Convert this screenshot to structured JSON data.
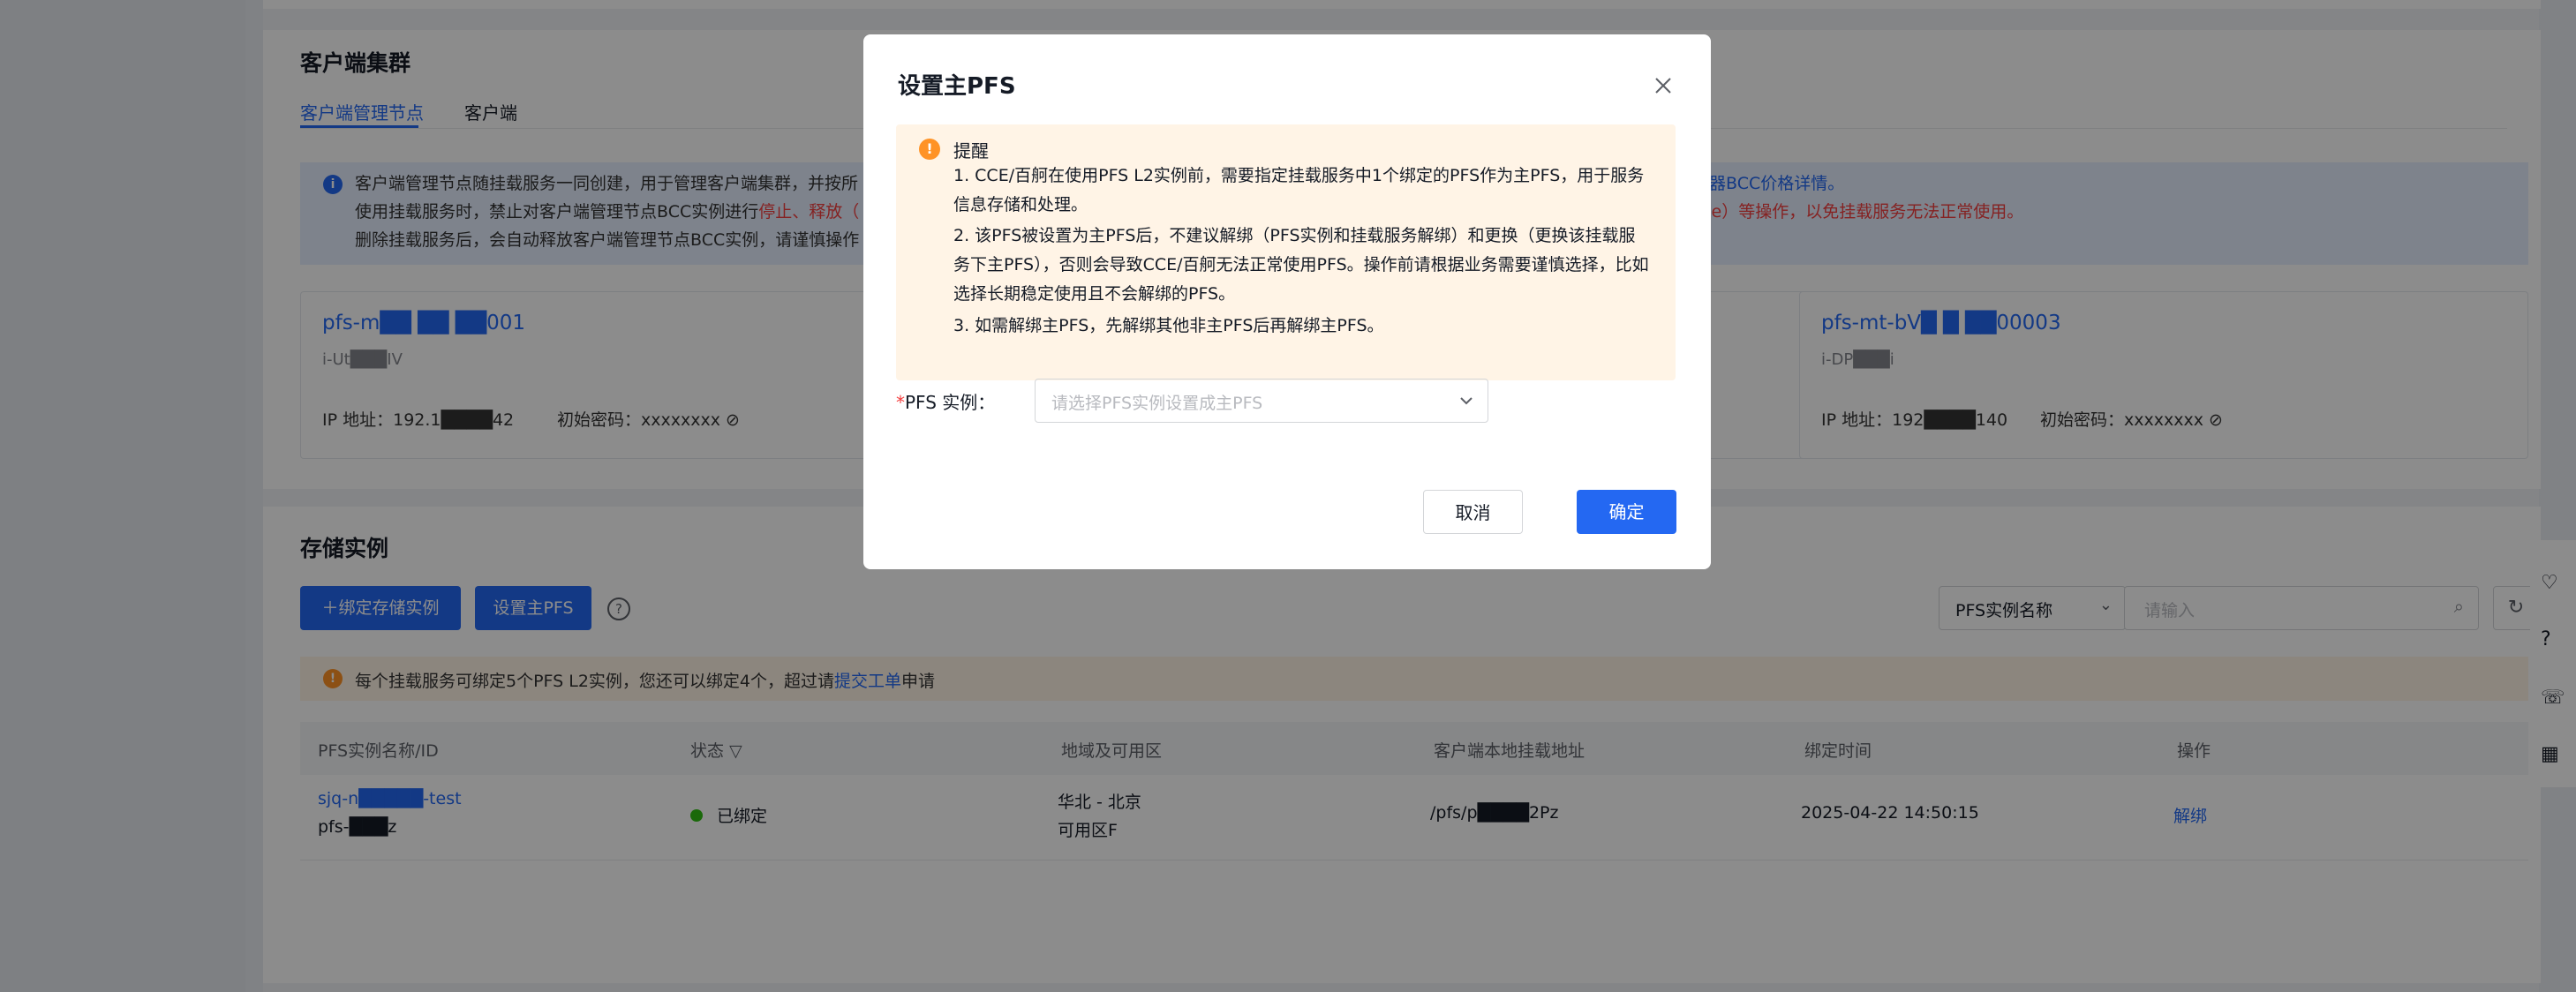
{
  "client_cluster": {
    "title": "客户端集群",
    "tabs": [
      "客户端管理节点",
      "客户端"
    ],
    "info_lines": [
      "客户端管理节点随挂载服务一同创建，用于管理客户端集群，并按所",
      "使用挂载服务时，禁止对客户端管理节点BCC实例进行",
      "删除挂载服务后，会自动释放客户端管理节点BCC实例，请谨慎操作"
    ],
    "info_red": "停止、释放（",
    "info_link": "器BCC价格详情。",
    "info_right": "me）等操作，以免挂载服务无法正常使用。",
    "nodes": [
      {
        "name": "pfs-m██ ██ ██001",
        "id": "i-Ut███IV",
        "ip_label": "IP 地址：",
        "ip": "192.1████42",
        "pwd_label": "初始密码：",
        "pwd": "xxxxxxxx"
      },
      {
        "name": "pfs-mt-bV█ █ ██00003",
        "id": "i-DP███i",
        "ip_label": "IP 地址：",
        "ip": "192████140",
        "pwd_label": "初始密码：",
        "pwd": "xxxxxxxx"
      }
    ]
  },
  "storage": {
    "title": "存储实例",
    "bind_button": "绑定存储实例",
    "set_main_button": "设置主PFS",
    "filter_select": "PFS实例名称",
    "search_placeholder": "请输入",
    "warn_text": "每个挂载服务可绑定5个PFS L2实例，您还可以绑定4个，超过请",
    "warn_link": "提交工单",
    "warn_suffix": "申请",
    "columns": [
      "PFS实例名称/ID",
      "状态",
      "地域及可用区",
      "客户端本地挂载地址",
      "绑定时间",
      "操作"
    ],
    "rows": [
      {
        "name": "sjq-n█████-test",
        "id": "pfs-███z",
        "status": "已绑定",
        "region": "华北 - 北京",
        "zone": "可用区F",
        "mount": "/pfs/p████2Pz",
        "time": "2025-04-22 14:50:15",
        "action": "解绑"
      }
    ]
  },
  "modal": {
    "title": "设置主PFS",
    "alert_title": "提醒",
    "alert_items": [
      "1. CCE/百舸在使用PFS L2实例前，需要指定挂载服务中1个绑定的PFS作为主PFS，用于服务信息存储和处理。",
      "2. 该PFS被设置为主PFS后，不建议解绑（PFS实例和挂载服务解绑）和更换（更换该挂载服务下主PFS），否则会导致CCE/百舸无法正常使用PFS。操作前请根据业务需要谨慎选择，比如选择长期稳定使用且不会解绑的PFS。",
      "3. 如需解绑主PFS，先解绑其他非主PFS后再解绑主PFS。"
    ],
    "field_label": "PFS 实例：",
    "field_required": "*",
    "select_placeholder": "请选择PFS实例设置成主PFS",
    "cancel": "取消",
    "confirm": "确定"
  }
}
